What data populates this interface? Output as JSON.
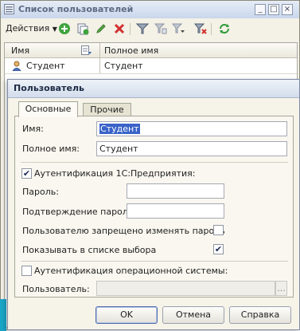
{
  "back_window": {
    "title": "Список пользователей",
    "title_buttons": [
      "_",
      "□",
      "×"
    ],
    "toolbar": {
      "actions_label": "Действия",
      "icons": [
        "add-icon",
        "copy-icon",
        "edit-icon",
        "delete-icon",
        "filter-icon",
        "filter-list-icon",
        "filter-dropdown-icon",
        "clear-filter-icon",
        "refresh-icon"
      ]
    },
    "grid": {
      "columns": [
        "Имя",
        "Полное имя"
      ],
      "rows": [
        {
          "name": "Студент",
          "full_name": "Студент"
        }
      ]
    }
  },
  "dialog": {
    "title": "Пользователь",
    "tabs": [
      {
        "label": "Основные",
        "active": true
      },
      {
        "label": "Прочие",
        "active": false
      }
    ],
    "fields": {
      "name_label": "Имя:",
      "name_value": "Студент",
      "fullname_label": "Полное имя:",
      "fullname_value": "Студент"
    },
    "auth_1c": {
      "label": "Аутентификация 1С:Предприятия:",
      "checked": true,
      "password_label": "Пароль:",
      "password_value": "",
      "confirm_label": "Подтверждение пароля:",
      "confirm_value": "",
      "forbid_change_label": "Пользователю запрещено изменять пароль",
      "forbid_change_checked": false,
      "show_in_list_label": "Показывать в списке выбора",
      "show_in_list_checked": true
    },
    "auth_os": {
      "label": "Аутентификация операционной системы:",
      "checked": false,
      "user_label": "Пользователь:",
      "user_value": "",
      "select_button": "..."
    },
    "buttons": {
      "ok": "OK",
      "cancel": "Отмена",
      "help": "Справка"
    }
  }
}
